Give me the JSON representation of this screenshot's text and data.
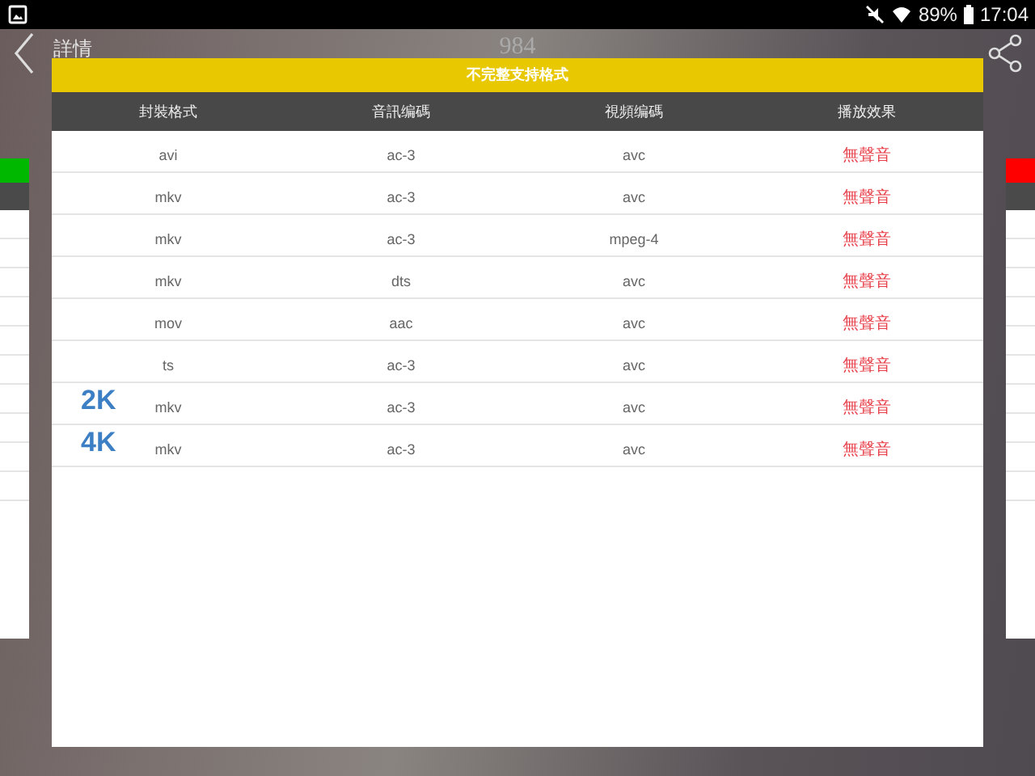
{
  "status_bar": {
    "battery_text": "89%",
    "time": "17:04"
  },
  "header": {
    "back_label": "詳情",
    "title": "984"
  },
  "dialog": {
    "title": "不完整支持格式",
    "columns": [
      "封裝格式",
      "音訊编碼",
      "視頻编碼",
      "播放效果"
    ],
    "rows": [
      {
        "container": "avi",
        "audio": "ac-3",
        "video": "avc",
        "result": "無聲音"
      },
      {
        "container": "mkv",
        "audio": "ac-3",
        "video": "avc",
        "result": "無聲音"
      },
      {
        "container": "mkv",
        "audio": "ac-3",
        "video": "mpeg-4",
        "result": "無聲音"
      },
      {
        "container": "mkv",
        "audio": "dts",
        "video": "avc",
        "result": "無聲音"
      },
      {
        "container": "mov",
        "audio": "aac",
        "video": "avc",
        "result": "無聲音"
      },
      {
        "container": "ts",
        "audio": "ac-3",
        "video": "avc",
        "result": "無聲音"
      },
      {
        "badge": "2K",
        "container": "mkv",
        "audio": "ac-3",
        "video": "avc",
        "result": "無聲音"
      },
      {
        "badge": "4K",
        "container": "mkv",
        "audio": "ac-3",
        "video": "avc",
        "result": "無聲音"
      }
    ]
  },
  "side_cards": [
    {
      "color": "#00b800"
    },
    {
      "color": "#ff0000"
    }
  ]
}
